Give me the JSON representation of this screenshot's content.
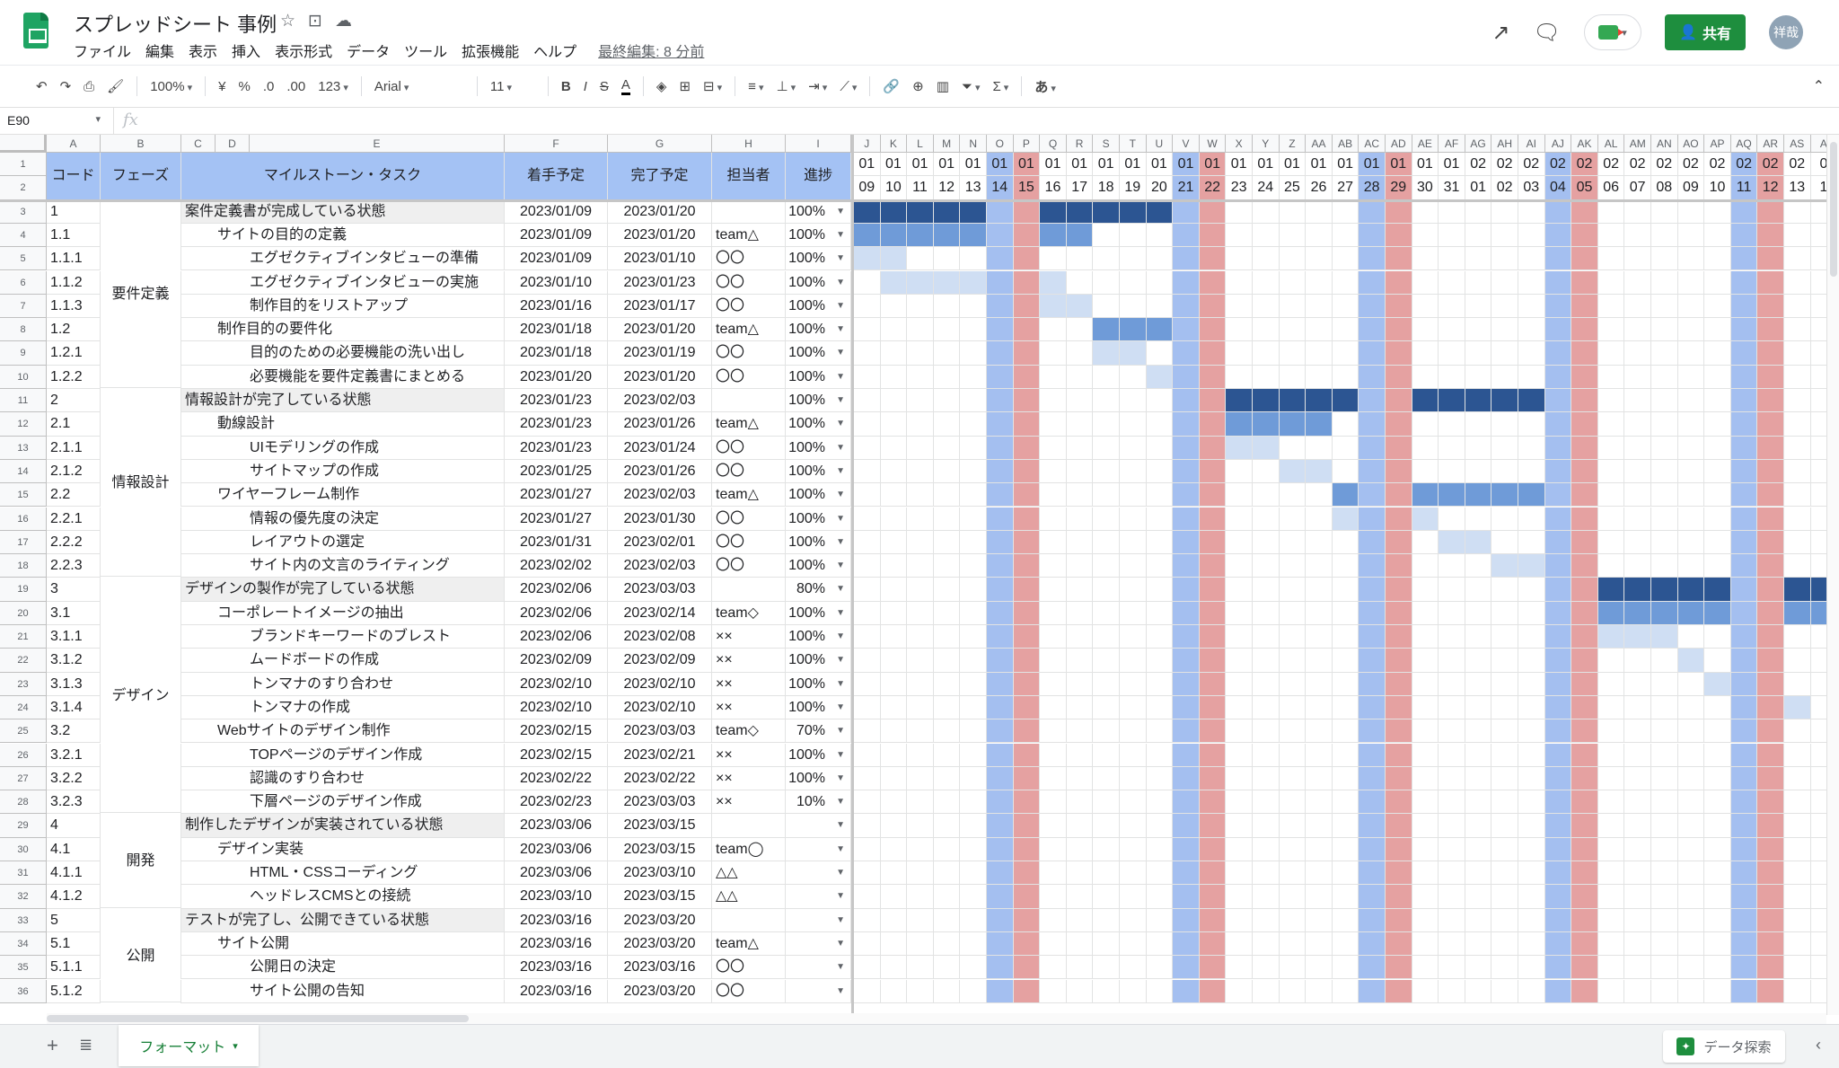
{
  "app": {
    "title": "スプレッドシート 事例",
    "last_edit": "最終編集: 8 分前",
    "share_label": "共有",
    "avatar_label": "祥哉"
  },
  "menu": [
    "ファイル",
    "編集",
    "表示",
    "挿入",
    "表示形式",
    "データ",
    "ツール",
    "拡張機能",
    "ヘルプ"
  ],
  "toolbar": {
    "zoom": "100%",
    "currency": "¥",
    "percent": "%",
    "dec_less": ".0",
    "dec_more": ".00",
    "num_format": "123",
    "font": "Arial",
    "font_size": "11",
    "ime": "あ"
  },
  "namebox": "E90",
  "fx": "fx",
  "colors": {
    "header_fill": "#a4c2f4",
    "saturday": "#a4bff0",
    "sunday": "#e5a1a1",
    "bar_dark": "#2c5592",
    "bar_mid": "#6f9bd8",
    "bar_light": "#cfdef3",
    "section_fill": "#efefef",
    "share_green": "#1e8e3e"
  },
  "left_col_letters": [
    "A",
    "B",
    "C",
    "D",
    "E",
    "F",
    "G",
    "H",
    "I"
  ],
  "gantt_col_letters": [
    "J",
    "K",
    "L",
    "M",
    "N",
    "O",
    "P",
    "Q",
    "R",
    "S",
    "T",
    "U",
    "V",
    "W",
    "X",
    "Y",
    "Z",
    "AA",
    "AB",
    "AC",
    "AD",
    "AE",
    "AF",
    "AG",
    "AH",
    "AI",
    "AJ",
    "AK",
    "AL",
    "AM",
    "AN",
    "AO",
    "AP",
    "AQ",
    "AR",
    "AS",
    "A"
  ],
  "headers": {
    "code": "コード",
    "phase": "フェーズ",
    "task": "マイルストーン・タスク",
    "start": "着手予定",
    "end": "完了予定",
    "owner": "担当者",
    "progress": "進捗"
  },
  "gantt_month": [
    "01",
    "01",
    "01",
    "01",
    "01",
    "01",
    "01",
    "01",
    "01",
    "01",
    "01",
    "01",
    "01",
    "01",
    "01",
    "01",
    "01",
    "01",
    "01",
    "01",
    "01",
    "01",
    "01",
    "02",
    "02",
    "02",
    "02",
    "02",
    "02",
    "02",
    "02",
    "02",
    "02",
    "02",
    "02",
    "02",
    "0"
  ],
  "gantt_day": [
    "09",
    "10",
    "11",
    "12",
    "13",
    "14",
    "15",
    "16",
    "17",
    "18",
    "19",
    "20",
    "21",
    "22",
    "23",
    "24",
    "25",
    "26",
    "27",
    "28",
    "29",
    "30",
    "31",
    "01",
    "02",
    "03",
    "04",
    "05",
    "06",
    "07",
    "08",
    "09",
    "10",
    "11",
    "12",
    "13",
    "1"
  ],
  "weekend": [
    "",
    "",
    "",
    "",
    "",
    "sat",
    "sun",
    "",
    "",
    "",
    "",
    "",
    "sat",
    "sun",
    "",
    "",
    "",
    "",
    "",
    "sat",
    "sun",
    "",
    "",
    "",
    "",
    "",
    "sat",
    "sun",
    "",
    "",
    "",
    "",
    "",
    "sat",
    "sun",
    "",
    ""
  ],
  "phases": [
    {
      "label": "要件定義",
      "from": 3,
      "to": 10
    },
    {
      "label": "情報設計",
      "from": 11,
      "to": 18
    },
    {
      "label": "デザイン",
      "from": 19,
      "to": 28
    },
    {
      "label": "開発",
      "from": 29,
      "to": 32
    },
    {
      "label": "公開",
      "from": 33,
      "to": 36
    }
  ],
  "rows": [
    {
      "n": "3",
      "code": "1",
      "level": 0,
      "task": "案件定義書が完成している状態",
      "start": "2023/01/09",
      "end": "2023/01/20",
      "owner": "",
      "progress": "100%"
    },
    {
      "n": "4",
      "code": "1.1",
      "level": 1,
      "task": "サイトの目的の定義",
      "start": "2023/01/09",
      "end": "2023/01/20",
      "owner": "team△",
      "progress": "100%"
    },
    {
      "n": "5",
      "code": "1.1.1",
      "level": 2,
      "task": "エグゼクティブインタビューの準備",
      "start": "2023/01/09",
      "end": "2023/01/10",
      "owner": "〇〇",
      "progress": "100%"
    },
    {
      "n": "6",
      "code": "1.1.2",
      "level": 2,
      "task": "エグゼクティブインタビューの実施",
      "start": "2023/01/10",
      "end": "2023/01/23",
      "owner": "〇〇",
      "progress": "100%"
    },
    {
      "n": "7",
      "code": "1.1.3",
      "level": 2,
      "task": "制作目的をリストアップ",
      "start": "2023/01/16",
      "end": "2023/01/17",
      "owner": "〇〇",
      "progress": "100%"
    },
    {
      "n": "8",
      "code": "1.2",
      "level": 1,
      "task": "制作目的の要件化",
      "start": "2023/01/18",
      "end": "2023/01/20",
      "owner": "team△",
      "progress": "100%"
    },
    {
      "n": "9",
      "code": "1.2.1",
      "level": 2,
      "task": "目的のための必要機能の洗い出し",
      "start": "2023/01/18",
      "end": "2023/01/19",
      "owner": "〇〇",
      "progress": "100%"
    },
    {
      "n": "10",
      "code": "1.2.2",
      "level": 2,
      "task": "必要機能を要件定義書にまとめる",
      "start": "2023/01/20",
      "end": "2023/01/20",
      "owner": "〇〇",
      "progress": "100%"
    },
    {
      "n": "11",
      "code": "2",
      "level": 0,
      "task": "情報設計が完了している状態",
      "start": "2023/01/23",
      "end": "2023/02/03",
      "owner": "",
      "progress": "100%"
    },
    {
      "n": "12",
      "code": "2.1",
      "level": 1,
      "task": "動線設計",
      "start": "2023/01/23",
      "end": "2023/01/26",
      "owner": "team△",
      "progress": "100%"
    },
    {
      "n": "13",
      "code": "2.1.1",
      "level": 2,
      "task": "UIモデリングの作成",
      "start": "2023/01/23",
      "end": "2023/01/24",
      "owner": "〇〇",
      "progress": "100%"
    },
    {
      "n": "14",
      "code": "2.1.2",
      "level": 2,
      "task": "サイトマップの作成",
      "start": "2023/01/25",
      "end": "2023/01/26",
      "owner": "〇〇",
      "progress": "100%"
    },
    {
      "n": "15",
      "code": "2.2",
      "level": 1,
      "task": "ワイヤーフレーム制作",
      "start": "2023/01/27",
      "end": "2023/02/03",
      "owner": "team△",
      "progress": "100%"
    },
    {
      "n": "16",
      "code": "2.2.1",
      "level": 2,
      "task": "情報の優先度の決定",
      "start": "2023/01/27",
      "end": "2023/01/30",
      "owner": "〇〇",
      "progress": "100%"
    },
    {
      "n": "17",
      "code": "2.2.2",
      "level": 2,
      "task": "レイアウトの選定",
      "start": "2023/01/31",
      "end": "2023/02/01",
      "owner": "〇〇",
      "progress": "100%"
    },
    {
      "n": "18",
      "code": "2.2.3",
      "level": 2,
      "task": "サイト内の文言のライティング",
      "start": "2023/02/02",
      "end": "2023/02/03",
      "owner": "〇〇",
      "progress": "100%"
    },
    {
      "n": "19",
      "code": "3",
      "level": 0,
      "task": "デザインの製作が完了している状態",
      "start": "2023/02/06",
      "end": "2023/03/03",
      "owner": "",
      "progress": "80%"
    },
    {
      "n": "20",
      "code": "3.1",
      "level": 1,
      "task": "コーポレートイメージの抽出",
      "start": "2023/02/06",
      "end": "2023/02/14",
      "owner": "team◇",
      "progress": "100%"
    },
    {
      "n": "21",
      "code": "3.1.1",
      "level": 2,
      "task": "ブランドキーワードのブレスト",
      "start": "2023/02/06",
      "end": "2023/02/08",
      "owner": "××",
      "progress": "100%"
    },
    {
      "n": "22",
      "code": "3.1.2",
      "level": 2,
      "task": "ムードボードの作成",
      "start": "2023/02/09",
      "end": "2023/02/09",
      "owner": "××",
      "progress": "100%"
    },
    {
      "n": "23",
      "code": "3.1.3",
      "level": 2,
      "task": "トンマナのすり合わせ",
      "start": "2023/02/10",
      "end": "2023/02/10",
      "owner": "××",
      "progress": "100%"
    },
    {
      "n": "24",
      "code": "3.1.4",
      "level": 2,
      "task": "トンマナの作成",
      "start": "2023/02/10",
      "end": "2023/02/10",
      "owner": "××",
      "progress": "100%"
    },
    {
      "n": "25",
      "code": "3.2",
      "level": 1,
      "task": "Webサイトのデザイン制作",
      "start": "2023/02/15",
      "end": "2023/03/03",
      "owner": "team◇",
      "progress": "70%"
    },
    {
      "n": "26",
      "code": "3.2.1",
      "level": 2,
      "task": "TOPページのデザイン作成",
      "start": "2023/02/15",
      "end": "2023/02/21",
      "owner": "××",
      "progress": "100%"
    },
    {
      "n": "27",
      "code": "3.2.2",
      "level": 2,
      "task": "認識のすり合わせ",
      "start": "2023/02/22",
      "end": "2023/02/22",
      "owner": "××",
      "progress": "100%"
    },
    {
      "n": "28",
      "code": "3.2.3",
      "level": 2,
      "task": "下層ページのデザイン作成",
      "start": "2023/02/23",
      "end": "2023/03/03",
      "owner": "××",
      "progress": "10%"
    },
    {
      "n": "29",
      "code": "4",
      "level": 0,
      "task": "制作したデザインが実装されている状態",
      "start": "2023/03/06",
      "end": "2023/03/15",
      "owner": "",
      "progress": ""
    },
    {
      "n": "30",
      "code": "4.1",
      "level": 1,
      "task": "デザイン実装",
      "start": "2023/03/06",
      "end": "2023/03/15",
      "owner": "team◯",
      "progress": ""
    },
    {
      "n": "31",
      "code": "4.1.1",
      "level": 2,
      "task": "HTML・CSSコーディング",
      "start": "2023/03/06",
      "end": "2023/03/10",
      "owner": "△△",
      "progress": ""
    },
    {
      "n": "32",
      "code": "4.1.2",
      "level": 2,
      "task": "ヘッドレスCMSとの接続",
      "start": "2023/03/10",
      "end": "2023/03/15",
      "owner": "△△",
      "progress": ""
    },
    {
      "n": "33",
      "code": "5",
      "level": 0,
      "task": "テストが完了し、公開できている状態",
      "start": "2023/03/16",
      "end": "2023/03/20",
      "owner": "",
      "progress": ""
    },
    {
      "n": "34",
      "code": "5.1",
      "level": 1,
      "task": "サイト公開",
      "start": "2023/03/16",
      "end": "2023/03/20",
      "owner": "team△",
      "progress": ""
    },
    {
      "n": "35",
      "code": "5.1.1",
      "level": 2,
      "task": "公開日の決定",
      "start": "2023/03/16",
      "end": "2023/03/16",
      "owner": "〇〇",
      "progress": ""
    },
    {
      "n": "36",
      "code": "5.1.2",
      "level": 2,
      "task": "サイト公開の告知",
      "start": "2023/03/16",
      "end": "2023/03/20",
      "owner": "〇〇",
      "progress": ""
    }
  ],
  "gantt_bars": [
    {
      "row": "3",
      "tone": "dark",
      "days": [
        0,
        1,
        2,
        3,
        4,
        7,
        8,
        9,
        10,
        11
      ]
    },
    {
      "row": "4",
      "tone": "mid",
      "days": [
        0,
        1,
        2,
        3,
        4,
        7,
        8
      ]
    },
    {
      "row": "5",
      "tone": "light",
      "days": [
        0,
        1
      ]
    },
    {
      "row": "6",
      "tone": "light",
      "days": [
        1,
        2,
        3,
        4,
        7
      ]
    },
    {
      "row": "7",
      "tone": "light",
      "days": [
        7,
        8
      ]
    },
    {
      "row": "8",
      "tone": "mid",
      "days": [
        9,
        10,
        11
      ]
    },
    {
      "row": "9",
      "tone": "light",
      "days": [
        9,
        10
      ]
    },
    {
      "row": "10",
      "tone": "light",
      "days": [
        11
      ]
    },
    {
      "row": "11",
      "tone": "dark",
      "days": [
        14,
        15,
        16,
        17,
        18,
        21,
        22,
        23,
        24,
        25
      ]
    },
    {
      "row": "12",
      "tone": "mid",
      "days": [
        14,
        15,
        16,
        17
      ]
    },
    {
      "row": "13",
      "tone": "light",
      "days": [
        14,
        15
      ]
    },
    {
      "row": "14",
      "tone": "light",
      "days": [
        16,
        17
      ]
    },
    {
      "row": "15",
      "tone": "mid",
      "days": [
        18,
        21,
        22,
        23,
        24,
        25
      ]
    },
    {
      "row": "16",
      "tone": "light",
      "days": [
        18,
        21
      ]
    },
    {
      "row": "17",
      "tone": "light",
      "days": [
        22,
        23
      ]
    },
    {
      "row": "18",
      "tone": "light",
      "days": [
        24,
        25
      ]
    },
    {
      "row": "19",
      "tone": "dark",
      "days": [
        28,
        29,
        30,
        31,
        32,
        35,
        36
      ]
    },
    {
      "row": "20",
      "tone": "mid",
      "days": [
        28,
        29,
        30,
        31,
        32,
        35,
        36
      ]
    },
    {
      "row": "21",
      "tone": "light",
      "days": [
        28,
        29,
        30
      ]
    },
    {
      "row": "22",
      "tone": "light",
      "days": [
        31
      ]
    },
    {
      "row": "23",
      "tone": "light",
      "days": [
        32
      ]
    },
    {
      "row": "24",
      "tone": "light",
      "days": [
        35
      ]
    },
    {
      "row": "25",
      "tone": "light",
      "days": []
    }
  ],
  "sheet_tab": "フォーマット",
  "explore_label": "データ探索"
}
